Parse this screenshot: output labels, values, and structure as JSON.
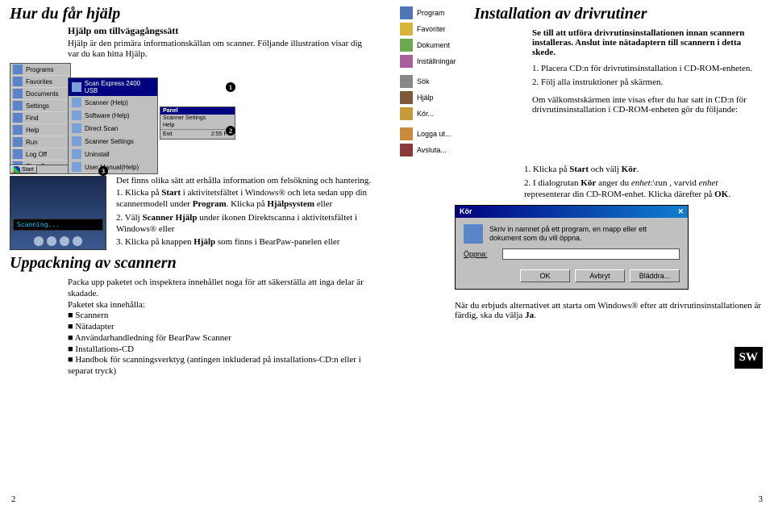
{
  "left": {
    "h1": "Hur du får hjälp",
    "sub_h3": "Hjälp om tillvägagångssätt",
    "sub_p": "Hjälp är den primära informationskällan om scanner. Följande illustration visar dig var du kan hitta Hjälp.",
    "startmenu": [
      "Programs",
      "Favorites",
      "Documents",
      "Settings",
      "Find",
      "Help",
      "Run",
      "Log Off",
      "Shut Down..."
    ],
    "flyout_title": "Scan Express 2400 USB",
    "flyout": [
      "Scanner (Help)",
      "Software (Help)",
      "Direct Scan",
      "Scanner Settings",
      "Uninstall",
      "User Manual(Help)"
    ],
    "panel_title": "Panel",
    "panel_lines": [
      "Scanner Settings",
      "Help"
    ],
    "panel_exit": "Exit",
    "panel_time": "2:55 PM",
    "start_label": "Start",
    "callouts": {
      "c1": "1",
      "c2": "2",
      "c3": "3"
    },
    "scanner_screen": "Scanning...",
    "info_p": "Det finns olika sätt att erhålla information om felsökning och hantering.",
    "info_list": [
      "1. Klicka på <b>Start</b> i aktivitetsfältet i Windows® och leta sedan upp din scannermodell under <b>Program</b>. Klicka på <b>Hjälpsystem</b> eller",
      "2. Välj <b>Scanner Hjälp</b> under ikonen Direktscanna i aktivitetsfältet i Windows® eller",
      "3. Klicka på knappen <b>Hjälp</b> som finns i BearPaw-panelen eller"
    ],
    "h1b": "Uppackning av scannern",
    "pack_p1": "Packa upp paketet och inspektera innehållet noga för att säkerställa att inga delar är skadade.",
    "pack_p2": "Paketet ska innehålla:",
    "pack_list": [
      "Scannern",
      "Nätadapter",
      "Användarhandledning för BearPaw Scanner",
      "Installations-CD",
      "Handbok för scanningsverktyg (antingen inkluderad på installations-CD:n eller i separat tryck)"
    ],
    "pagenum": "2"
  },
  "right": {
    "h1": "Installation av drivrutiner",
    "intro": "Se till att utföra drivrutinsinstallationen innan scannern installeras. Anslut inte nätadaptern till scannern i detta skede.",
    "winmenu": [
      "Program",
      "Favoriter",
      "Dokument",
      "Inställningar",
      "Sök",
      "Hjälp",
      "Kör...",
      "Logga ut...",
      "Avsluta..."
    ],
    "steps_a": [
      "1. Placera CD:n för drivrutinsinstallation i CD-ROM-enheten.",
      "2. Följ alla instruktioner på skärmen."
    ],
    "noscreen": "Om välkomstskärmen inte visas efter du har satt in CD:n för drivrutinsinstallation i CD-ROM-enheten gör du följande:",
    "steps_b": [
      "1. Klicka på <b>Start</b> och välj <b>Kör</b>.",
      "2. I dialogrutan <b>Kör</b> anger du <i>enhet</i>:\\run , varvid <i>enhet</i> representerar din CD-ROM-enhet. Klicka därefter på <b>OK</b>."
    ],
    "kor": {
      "title": "Kör",
      "text": "Skriv in namnet på ett program, en mapp eller ett dokument som du vill öppna.",
      "label": "Öppna:",
      "value": "",
      "ok": "OK",
      "cancel": "Avbryt",
      "browse": "Bläddra..."
    },
    "restart": "När du erbjuds alternativet att starta om Windows® efter att drivrutinsinstallationen är färdig, ska du välja <b>Ja</b>.",
    "sw": "SW",
    "pagenum": "3"
  }
}
